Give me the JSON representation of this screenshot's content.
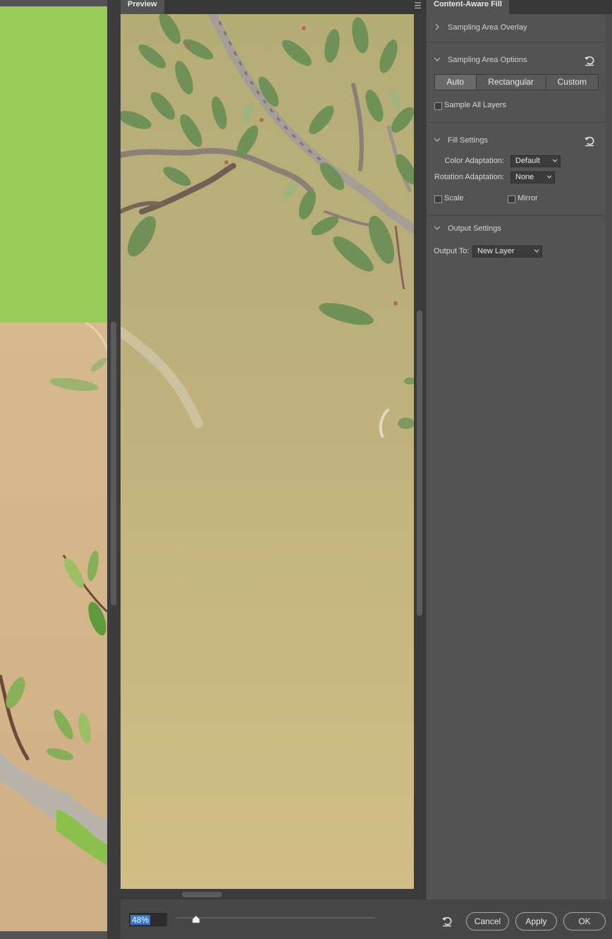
{
  "preview": {
    "tab_label": "Preview",
    "menu_icon": "hamburger-menu-icon",
    "zoom_value": "48%",
    "zoom_slider_fraction": 0.1
  },
  "panel": {
    "tab_label": "Content-Aware Fill",
    "sections": {
      "sampling_overlay": {
        "title": "Sampling Area Overlay",
        "expanded": false
      },
      "sampling_options": {
        "title": "Sampling Area Options",
        "modes": [
          "Auto",
          "Rectangular",
          "Custom"
        ],
        "active_mode": "Auto",
        "sample_all_layers_label": "Sample All Layers",
        "sample_all_layers_checked": false
      },
      "fill_settings": {
        "title": "Fill Settings",
        "color_adaptation_label": "Color Adaptation:",
        "color_adaptation_value": "Default",
        "rotation_adaptation_label": "Rotation Adaptation:",
        "rotation_adaptation_value": "None",
        "scale_label": "Scale",
        "scale_checked": false,
        "mirror_label": "Mirror",
        "mirror_checked": false
      },
      "output_settings": {
        "title": "Output Settings",
        "output_to_label": "Output To:",
        "output_to_value": "New Layer"
      }
    },
    "footer": {
      "cancel_label": "Cancel",
      "apply_label": "Apply",
      "ok_label": "OK"
    }
  },
  "colors": {
    "panel_bg": "#535353",
    "canvas_green": "#98cb57",
    "highlight_blue": "#3877c7"
  }
}
